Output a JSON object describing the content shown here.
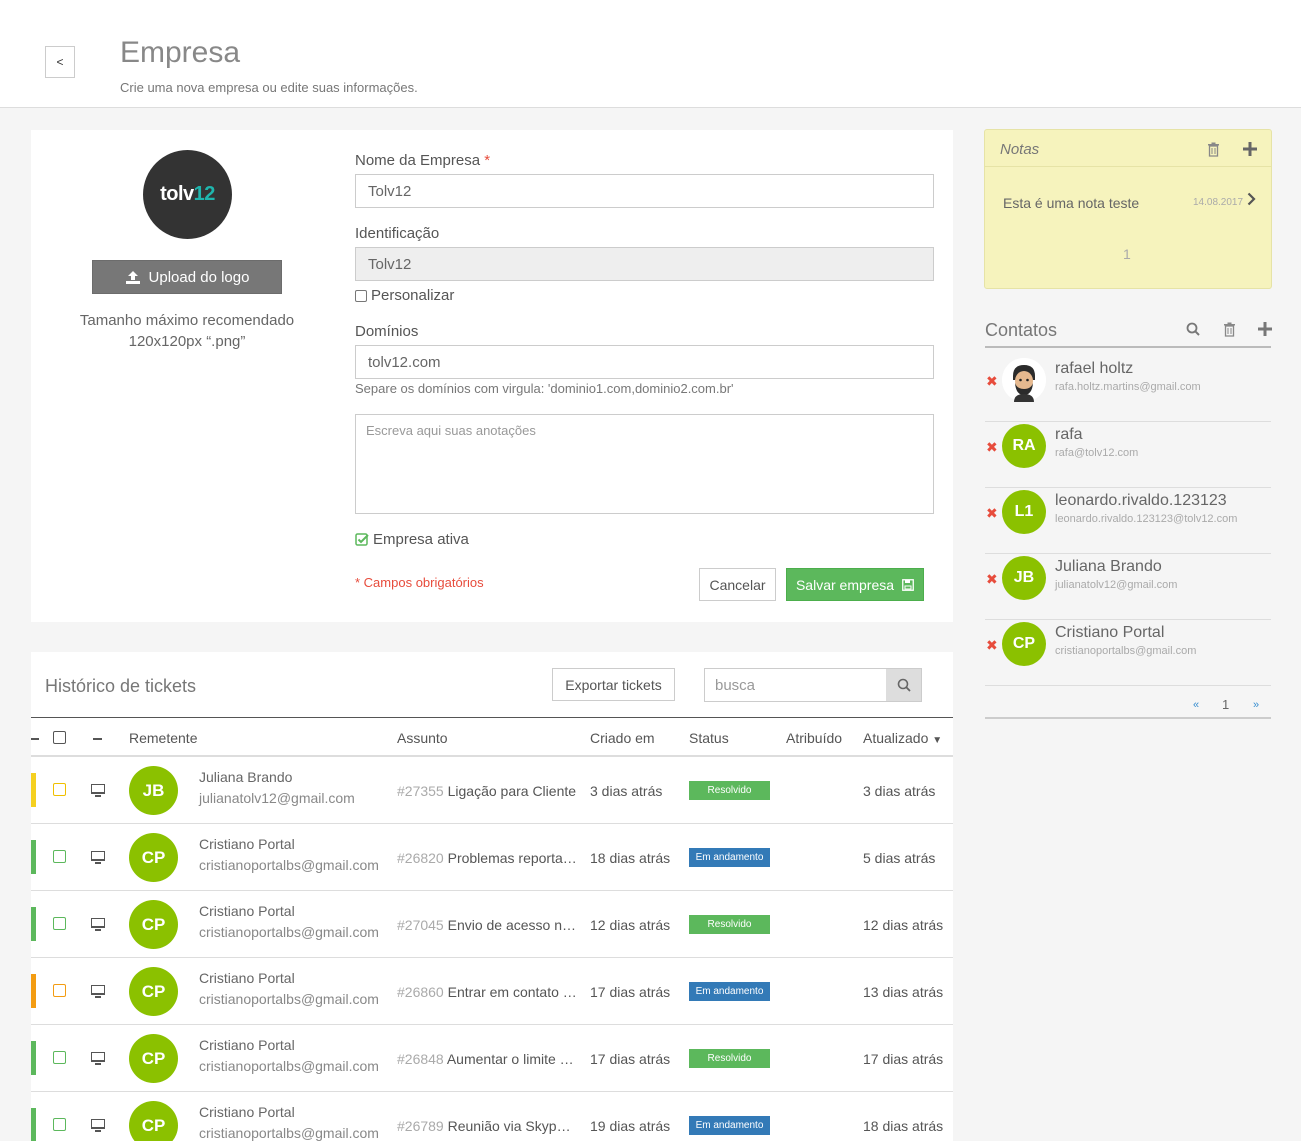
{
  "header": {
    "back_label": "<",
    "title": "Empresa",
    "subtitle": "Crie uma nova empresa ou edite suas informações."
  },
  "form": {
    "logo_text_main": "tolv",
    "logo_text_accent": "12",
    "upload_label": "Upload do logo",
    "upload_hint_line1": "Tamanho máximo recomendado",
    "upload_hint_line2": "120x120px “.png”",
    "name_label": "Nome da Empresa",
    "required_star": "*",
    "name_value": "Tolv12",
    "id_label": "Identificação",
    "id_value": "Tolv12",
    "customize_label": "Personalizar",
    "domains_label": "Domínios",
    "domains_value": "tolv12.com",
    "domains_help": "Separe os domínios com virgula: 'dominio1.com,dominio2.com.br'",
    "notes_placeholder": "Escreva aqui suas anotações",
    "active_label": "Empresa ativa",
    "required_note": "* Campos obrigatórios",
    "cancel_label": "Cancelar",
    "save_label": "Salvar empresa"
  },
  "tickets": {
    "title": "Histórico de tickets",
    "export_label": "Exportar tickets",
    "search_placeholder": "busca",
    "columns": {
      "sender": "Remetente",
      "subject": "Assunto",
      "created": "Criado em",
      "status": "Status",
      "assigned": "Atribuído",
      "updated": "Atualizado"
    },
    "rows": [
      {
        "priority_color": "#f5d020",
        "cb_color": "#f0c000",
        "initials": "JB",
        "name": "Juliana Brando",
        "email": "julianatolv12@gmail.com",
        "id": "#27355",
        "subject": "Ligação para Cliente",
        "created": "3 dias atrás",
        "status": "Resolvido",
        "status_color": "#5cb85c",
        "updated": "3 dias atrás"
      },
      {
        "priority_color": "#5cb85c",
        "cb_color": "#5cb85c",
        "initials": "CP",
        "name": "Cristiano Portal",
        "email": "cristianoportalbs@gmail.com",
        "id": "#26820",
        "subject": "Problemas reportados no sistema",
        "created": "18 dias atrás",
        "status": "Em andamento",
        "status_color": "#337ab7",
        "updated": "5 dias atrás"
      },
      {
        "priority_color": "#5cb85c",
        "cb_color": "#5cb85c",
        "initials": "CP",
        "name": "Cristiano Portal",
        "email": "cristianoportalbs@gmail.com",
        "id": "#27045",
        "subject": "Envio de acesso não recebido",
        "created": "12 dias atrás",
        "status": "Resolvido",
        "status_color": "#5cb85c",
        "updated": "12 dias atrás"
      },
      {
        "priority_color": "#f39c12",
        "cb_color": "#f39c12",
        "initials": "CP",
        "name": "Cristiano Portal",
        "email": "cristianoportalbs@gmail.com",
        "id": "#26860",
        "subject": "Entrar em contato com cliente",
        "created": "17 dias atrás",
        "status": "Em andamento",
        "status_color": "#337ab7",
        "updated": "13 dias atrás"
      },
      {
        "priority_color": "#5cb85c",
        "cb_color": "#5cb85c",
        "initials": "CP",
        "name": "Cristiano Portal",
        "email": "cristianoportalbs@gmail.com",
        "id": "#26848",
        "subject": "Aumentar o limite de usuários",
        "created": "17 dias atrás",
        "status": "Resolvido",
        "status_color": "#5cb85c",
        "updated": "17 dias atrás"
      },
      {
        "priority_color": "#5cb85c",
        "cb_color": "#5cb85c",
        "initials": "CP",
        "name": "Cristiano Portal",
        "email": "cristianoportalbs@gmail.com",
        "id": "#26789",
        "subject": "Reunião via Skype com cliente",
        "created": "19 dias atrás",
        "status": "Em andamento",
        "status_color": "#337ab7",
        "updated": "18 dias atrás"
      }
    ]
  },
  "notes": {
    "title": "Notas",
    "items": [
      {
        "text": "Esta é uma nota teste",
        "date": "14.08.2017"
      }
    ],
    "page": "1"
  },
  "contacts": {
    "title": "Contatos",
    "items": [
      {
        "initials": "",
        "photo": true,
        "name": "rafael holtz",
        "email": "rafa.holtz.martins@gmail.com"
      },
      {
        "initials": "RA",
        "photo": false,
        "name": "rafa",
        "email": "rafa@tolv12.com"
      },
      {
        "initials": "L1",
        "photo": false,
        "name": "leonardo.rivaldo.123123",
        "email": "leonardo.rivaldo.123123@tolv12.com"
      },
      {
        "initials": "JB",
        "photo": false,
        "name": "Juliana Brando",
        "email": "julianatolv12@gmail.com"
      },
      {
        "initials": "CP",
        "photo": false,
        "name": "Cristiano Portal",
        "email": "cristianoportalbs@gmail.com"
      }
    ],
    "pager": {
      "prev": "«",
      "page": "1",
      "next": "»"
    }
  },
  "colors": {
    "success": "#5cb85c",
    "primary": "#337ab7",
    "danger": "#e74c3c",
    "avatar": "#8bc100",
    "notes_bg": "#f6f3bd"
  }
}
